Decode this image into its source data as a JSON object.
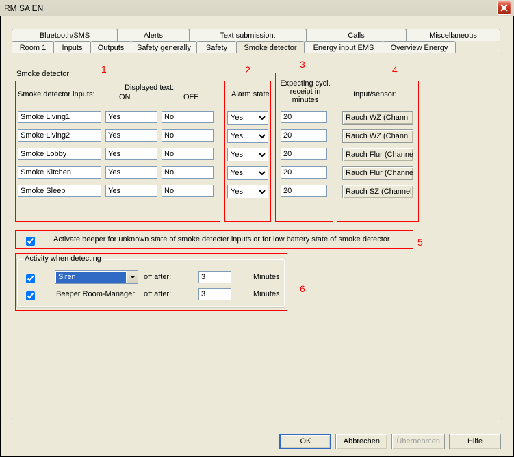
{
  "window": {
    "title": "RM SA EN"
  },
  "tabs": {
    "row1": [
      {
        "label": "Bluetooth/SMS"
      },
      {
        "label": "Alerts"
      },
      {
        "label": "Text submission:"
      },
      {
        "label": "Calls"
      },
      {
        "label": "Miscellaneous"
      }
    ],
    "row2": [
      {
        "label": "Room 1"
      },
      {
        "label": "Inputs"
      },
      {
        "label": "Outputs"
      },
      {
        "label": "Safety generally"
      },
      {
        "label": "Safety"
      },
      {
        "label": "Smoke detector",
        "active": true
      },
      {
        "label": "Energy input EMS"
      },
      {
        "label": "Overview Energy"
      }
    ]
  },
  "section": {
    "title": "Smoke detector:",
    "headers": {
      "inputs": "Smoke detector inputs:",
      "displayed": "Displayed text:",
      "on": "ON",
      "off": "OFF",
      "alarm": "Alarm state",
      "cycl": "Expecting cycl. receipt in minutes",
      "sensor": "Input/sensor:"
    },
    "rows": [
      {
        "name": "Smoke Living1",
        "on": "Yes",
        "off": "No",
        "alarm": "Yes",
        "cycl": "20",
        "sensor": "Rauch WZ  (Chann"
      },
      {
        "name": "Smoke Living2",
        "on": "Yes",
        "off": "No",
        "alarm": "Yes",
        "cycl": "20",
        "sensor": "Rauch WZ  (Chann"
      },
      {
        "name": "Smoke Lobby",
        "on": "Yes",
        "off": "No",
        "alarm": "Yes",
        "cycl": "20",
        "sensor": "Rauch Flur  (Channe"
      },
      {
        "name": "Smoke Kitchen",
        "on": "Yes",
        "off": "No",
        "alarm": "Yes",
        "cycl": "20",
        "sensor": "Rauch Flur  (Channe"
      },
      {
        "name": "Smoke Sleep",
        "on": "Yes",
        "off": "No",
        "alarm": "Yes",
        "cycl": "20",
        "sensor": "Rauch SZ  (Channel"
      }
    ]
  },
  "beeper": {
    "label": "Activate beeper for unknown state of smoke detecter inputs or for low battery state of smoke detector"
  },
  "activity": {
    "title": "Activity when detecting",
    "siren": "Siren",
    "off_after": "off after:",
    "minutes": "Minutes",
    "beeper_rm": "Beeper Room-Manager",
    "val1": "3",
    "val2": "3"
  },
  "buttons": {
    "ok": "OK",
    "cancel": "Abbrechen",
    "apply": "Übernehmen",
    "help": "Hilfe"
  },
  "annotations": {
    "n1": "1",
    "n2": "2",
    "n3": "3",
    "n4": "4",
    "n5": "5",
    "n6": "6"
  }
}
